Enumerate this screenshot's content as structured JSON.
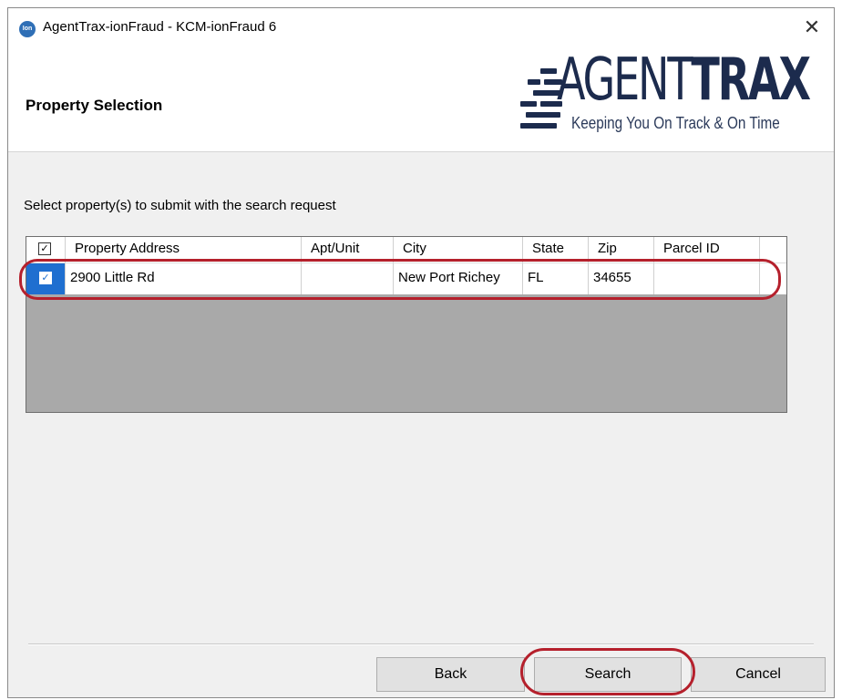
{
  "window": {
    "title": "AgentTrax-ionFraud - KCM-ionFraud 6",
    "close_glyph": "✕",
    "icon": "app-icon",
    "icon_text": "Ion"
  },
  "header": {
    "title": "Property Selection",
    "logo_text_light": "AGENT",
    "logo_text_bold": "TRAX",
    "logo_tagline": "Keeping You On Track & On Time"
  },
  "instruction": "Select property(s) to submit with the search request",
  "table": {
    "select_all_checked": true,
    "columns": [
      "Property Address",
      "Apt/Unit",
      "City",
      "State",
      "Zip",
      "Parcel ID"
    ],
    "rows": [
      {
        "checked": true,
        "property_address": "2900 Little Rd",
        "apt_unit": "",
        "city": "New Port Richey",
        "state": "FL",
        "zip": "34655",
        "parcel_id": ""
      }
    ]
  },
  "buttons": {
    "back": "Back",
    "search": "Search",
    "cancel": "Cancel"
  },
  "colors": {
    "highlight": "#b5202c",
    "selection": "#1f6fd0",
    "logo": "#1c2b4d"
  }
}
